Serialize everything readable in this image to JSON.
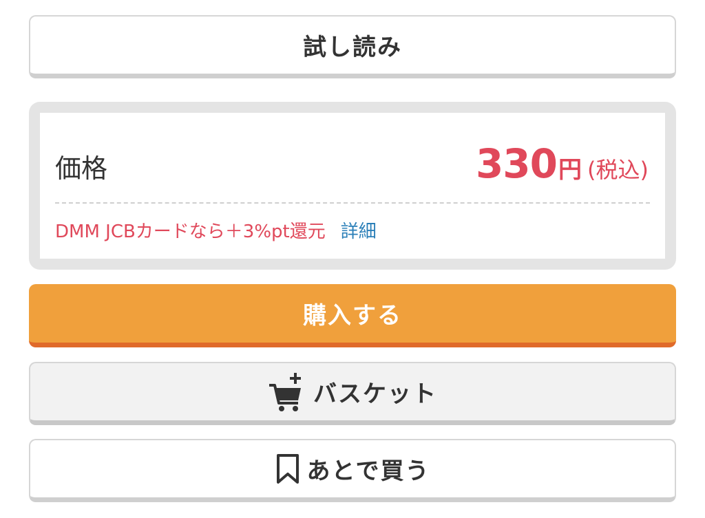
{
  "trial_button": {
    "label": "試し読み"
  },
  "price": {
    "label": "価格",
    "amount": "330",
    "unit": "円",
    "tax_note": "(税込)",
    "campaign_text": "DMM JCBカードなら＋3%pt還元",
    "detail_link": "詳細"
  },
  "buy_button": {
    "label": "購入する"
  },
  "basket_button": {
    "label": "バスケット",
    "icon": "cart-plus-icon"
  },
  "later_button": {
    "label": "あとで買う",
    "icon": "bookmark-icon"
  },
  "colors": {
    "accent_orange": "#f0a03c",
    "price_red": "#e0485a",
    "link_blue": "#2a7fb8"
  }
}
